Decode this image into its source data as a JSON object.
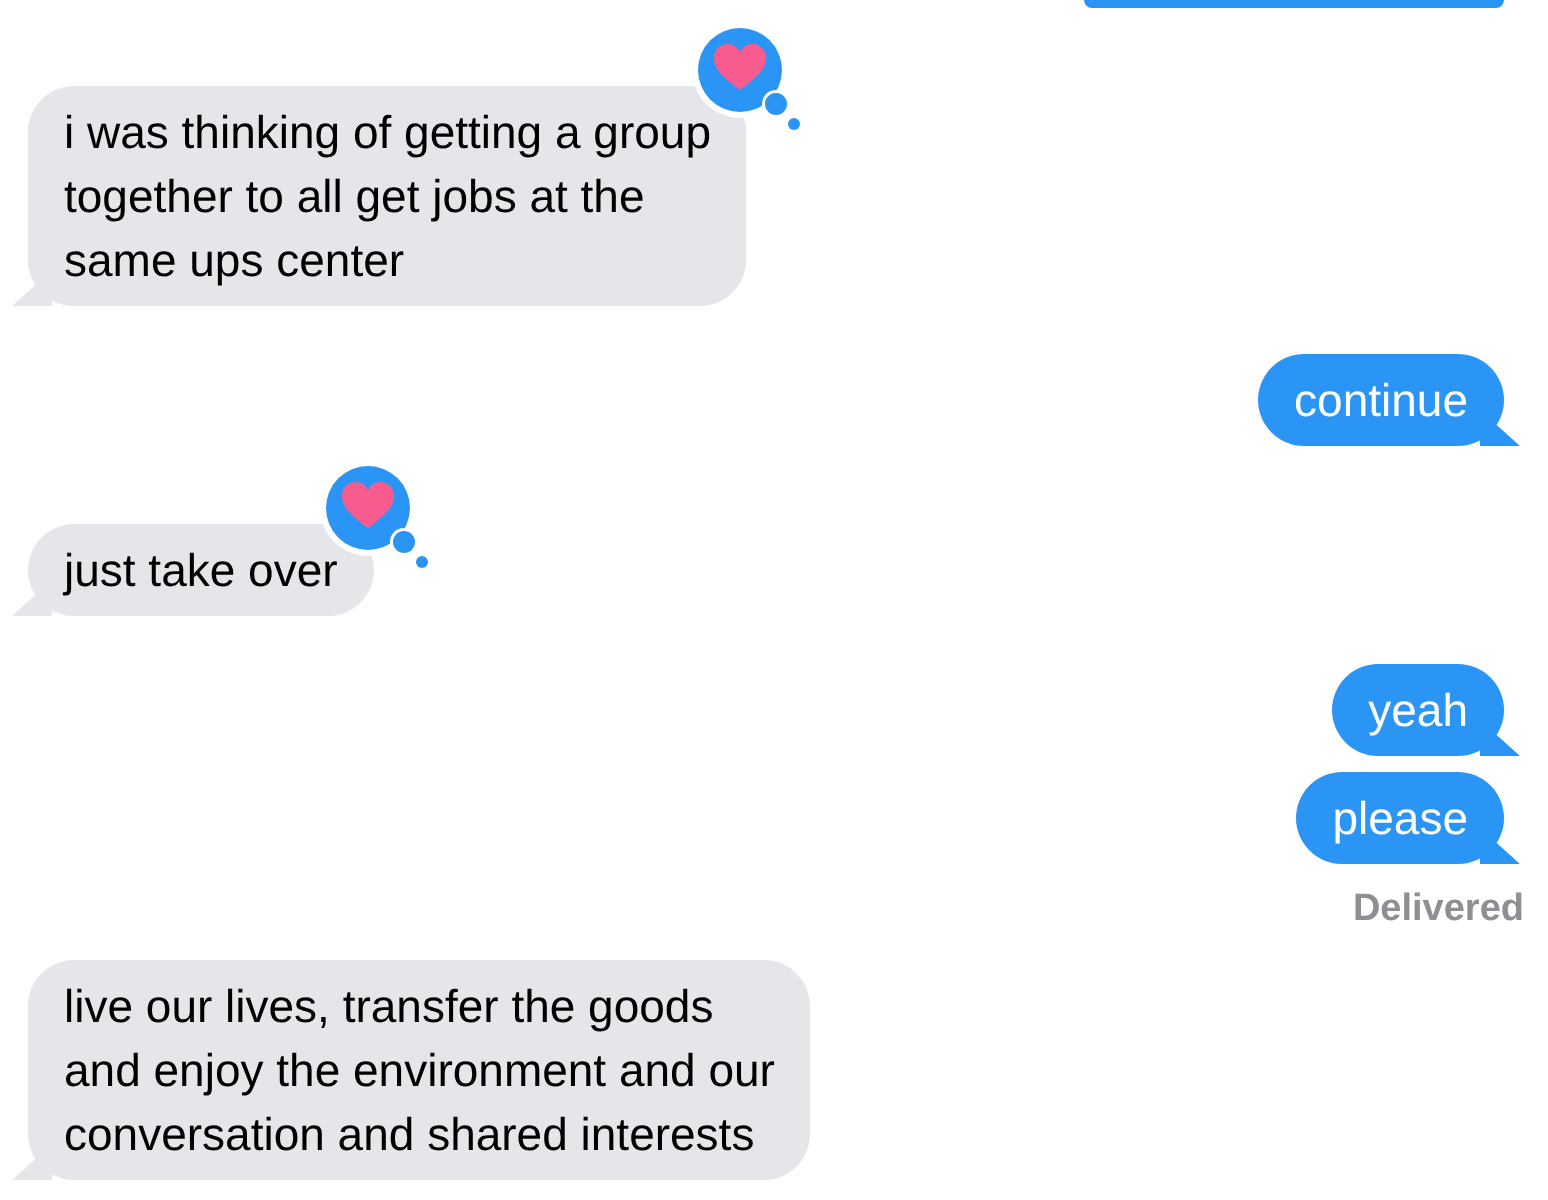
{
  "messages": [
    {
      "kind": "cut"
    },
    {
      "kind": "received",
      "text": "i was thinking of getting a group\ntogether to all get jobs at the\nsame ups center",
      "hearted": true
    },
    {
      "kind": "sent",
      "text": "continue"
    },
    {
      "kind": "received",
      "text": "just take over",
      "hearted": true
    },
    {
      "kind": "sent",
      "text": "yeah"
    },
    {
      "kind": "sent",
      "text": "please",
      "status": "Delivered"
    },
    {
      "kind": "received",
      "text": "live our lives, transfer the goods\nand enjoy the environment and our\nconversation and shared interests"
    }
  ]
}
